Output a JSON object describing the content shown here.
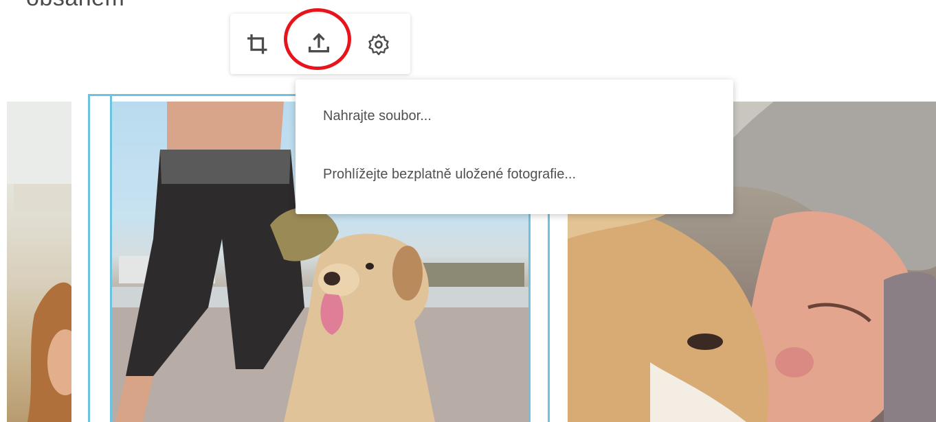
{
  "heading": "obsahem",
  "toolbar": {
    "buttons": [
      {
        "name": "crop-icon",
        "label": "Crop"
      },
      {
        "name": "upload-icon",
        "label": "Upload"
      },
      {
        "name": "gear-icon",
        "label": "Settings"
      }
    ],
    "highlight_color": "#e8141b"
  },
  "upload_menu": {
    "items": [
      {
        "label": "Nahrajte soubor..."
      },
      {
        "label": "Prohlížejte bezplatně uložené fotografie..."
      }
    ]
  },
  "gallery": {
    "selection_color": "#6cc3e0",
    "photos": [
      {
        "name": "photo-left"
      },
      {
        "name": "photo-man-with-dog"
      },
      {
        "name": "photo-woman-hugging-dog"
      }
    ]
  }
}
